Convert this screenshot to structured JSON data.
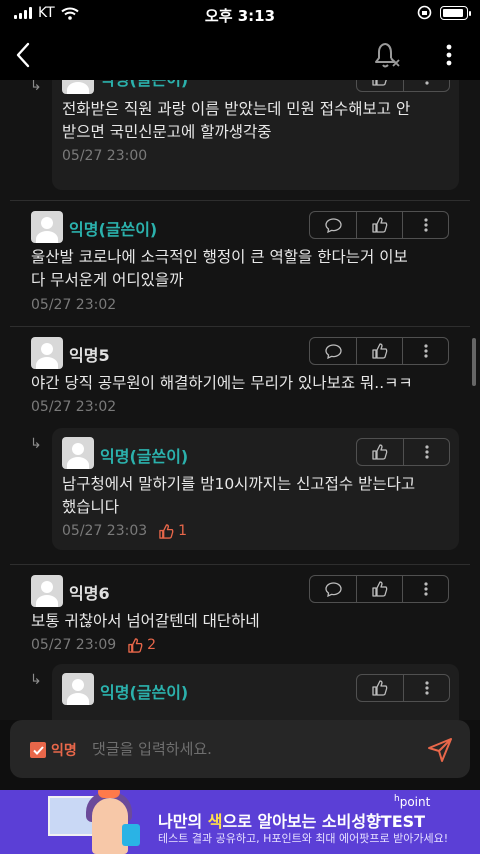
{
  "status_bar": {
    "carrier": "KT",
    "time": "오후 3:13",
    "battery_level": 0.9
  },
  "nav": {
    "back_icon": "chevron-left-icon",
    "bell_icon": "bell-off-icon",
    "more_icon": "more-vertical-icon"
  },
  "comments": [
    {
      "type": "reply",
      "author": "익명(글쓴이)",
      "is_author": true,
      "text_lines": [
        "전화받은 직원 과랑 이름 받았는데 민원 접수해보고 안",
        "받으면 국민신문고에 할까생각중"
      ],
      "time": "05/27 23:00"
    },
    {
      "type": "comment",
      "author": "익명(글쓴이)",
      "is_author": true,
      "text_lines": [
        "울산발 코로나에 소극적인 행정이 큰 역할을 한다는거 이보",
        "다 무서운게 어디있을까"
      ],
      "time": "05/27 23:02"
    },
    {
      "type": "comment",
      "author": "익명5",
      "is_author": false,
      "text_lines": [
        "야간 당직 공무원이 해결하기에는 무리가 있나보죠 뭐..ㅋㅋ"
      ],
      "time": "05/27 23:02"
    },
    {
      "type": "reply",
      "author": "익명(글쓴이)",
      "is_author": true,
      "text_lines": [
        "남구청에서 말하기를 밤10시까지는 신고접수 받는다고",
        "했습니다"
      ],
      "time": "05/27 23:03",
      "likes": "1"
    },
    {
      "type": "comment",
      "author": "익명6",
      "is_author": false,
      "text_lines": [
        "보통 귀찮아서 넘어갈텐데 대단하네"
      ],
      "time": "05/27 23:09",
      "likes": "2"
    },
    {
      "type": "reply",
      "author": "익명(글쓴이)",
      "is_author": true,
      "text_lines": [],
      "time": ""
    }
  ],
  "input_bar": {
    "anonymous_label": "익명",
    "anonymous_checked": true,
    "placeholder": "댓글을 입력하세요."
  },
  "ad": {
    "title_part1": "나만의 ",
    "title_highlight": "색",
    "title_part2": "으로 알아보는 소비성향TEST",
    "subtitle": "테스트 결과 공유하고, H포인트와 최대 에어팟프로 받아가세요!",
    "brand": "point",
    "brand_prefix": "h"
  },
  "colors": {
    "author_name": "#2bb1ac",
    "accent": "#e8674a",
    "ad_bg": "#5b3fd6"
  }
}
